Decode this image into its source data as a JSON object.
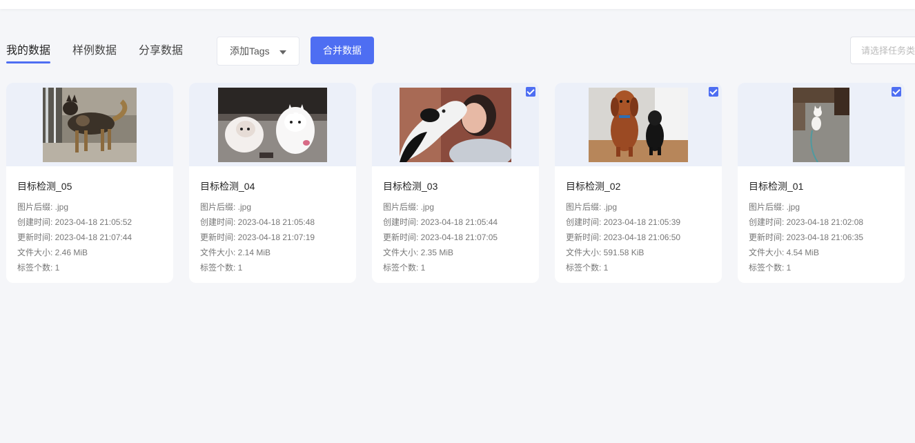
{
  "tabs": [
    {
      "label": "我的数据",
      "active": true
    },
    {
      "label": "样例数据",
      "active": false
    },
    {
      "label": "分享数据",
      "active": false
    }
  ],
  "tag_select": {
    "label": "添加Tags"
  },
  "merge_button": {
    "label": "合并数据"
  },
  "task_select": {
    "placeholder": "请选择任务类型"
  },
  "colors": {
    "accent": "#4e6ef2",
    "background": "#f5f6f9",
    "thumb_bg": "#ecf0f9"
  },
  "cards": [
    {
      "title": "目标检测_05",
      "suffix": "图片后缀: .jpg",
      "created": "创建时间: 2023-04-18 21:05:52",
      "updated": "更新时间: 2023-04-18 21:07:44",
      "size": "文件大小: 2.46 MiB",
      "tags": "标签个数: 1",
      "checked": false,
      "image": "dog-standing-photo"
    },
    {
      "title": "目标检测_04",
      "suffix": "图片后缀: .jpg",
      "created": "创建时间: 2023-04-18 21:05:48",
      "updated": "更新时间: 2023-04-18 21:07:19",
      "size": "文件大小: 2.14 MiB",
      "tags": "标签个数: 1",
      "checked": false,
      "image": "white-dogs-photo"
    },
    {
      "title": "目标检测_03",
      "suffix": "图片后缀: .jpg",
      "created": "创建时间: 2023-04-18 21:05:44",
      "updated": "更新时间: 2023-04-18 21:07:05",
      "size": "文件大小: 2.35 MiB",
      "tags": "标签个数: 1",
      "checked": true,
      "image": "dog-kissing-woman-photo"
    },
    {
      "title": "目标检测_02",
      "suffix": "图片后缀: .jpg",
      "created": "创建时间: 2023-04-18 21:05:39",
      "updated": "更新时间: 2023-04-18 21:06:50",
      "size": "文件大小: 591.58 KiB",
      "tags": "标签个数: 1",
      "checked": true,
      "image": "two-dogs-photo"
    },
    {
      "title": "目标检测_01",
      "suffix": "图片后缀: .jpg",
      "created": "创建时间: 2023-04-18 21:02:08",
      "updated": "更新时间: 2023-04-18 21:06:35",
      "size": "文件大小: 4.54 MiB",
      "tags": "标签个数: 1",
      "checked": true,
      "image": "white-cat-photo"
    }
  ]
}
